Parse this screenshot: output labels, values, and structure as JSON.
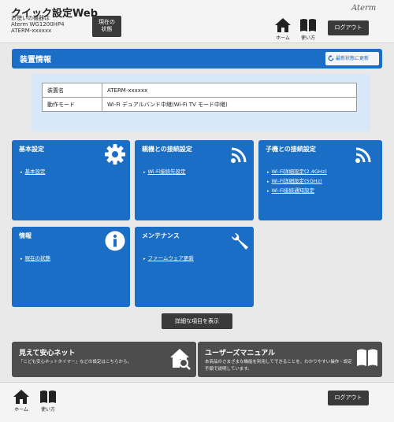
{
  "header": {
    "title": "クイック設定Web",
    "device_label": "お使いの機器は",
    "device_model": "Aterm WG1200HP4",
    "device_name": "ATERM-xxxxxx",
    "status_button": "現在の\n状態",
    "home_label": "ホーム",
    "help_label": "使い方",
    "brand": "Aterm",
    "logout_label": "ログアウト"
  },
  "device_info": {
    "title": "装置情報",
    "refresh_label": "最新状態に更新",
    "rows": [
      {
        "key": "装置名",
        "value": "ATERM-xxxxxx"
      },
      {
        "key": "動作モード",
        "value": "Wi-Fi デュアルバンド中継(Wi-Fi TV モード中継)"
      }
    ]
  },
  "tiles": [
    {
      "title": "基本設定",
      "icon": "gear-icon",
      "links": [
        "基本設定"
      ]
    },
    {
      "title": "親機との接続設定",
      "icon": "wifi-icon",
      "links": [
        "Wi-Fi接続先設定"
      ]
    },
    {
      "title": "子機との接続設定",
      "icon": "wifi-icon",
      "links": [
        "Wi-Fi詳細設定(2.4GHz)",
        "Wi-Fi詳細設定(5GHz)",
        "Wi-Fi接続通知設定"
      ]
    },
    {
      "title": "情報",
      "icon": "info-icon",
      "links": [
        "現在の状態"
      ]
    },
    {
      "title": "メンテナンス",
      "icon": "wrench-icon",
      "links": [
        "ファームウェア更新"
      ]
    }
  ],
  "detail_button": "詳細な項目を表示",
  "banners": [
    {
      "title": "見えて安心ネット",
      "desc": "「こども安心ネットタイマー」などの設定はこちらから。",
      "icon": "house-search-icon"
    },
    {
      "title": "ユーザーズマニュアル",
      "desc": "本商品のさまざまな機能を利用してできることを、わかりやすい操作・設定手順で説明しています。",
      "icon": "book-icon"
    }
  ],
  "footer": {
    "home_label": "ホーム",
    "help_label": "使い方",
    "logout_label": "ログアウト"
  },
  "colors": {
    "accent": "#1a6ec5",
    "dark_button": "#3a3a3a",
    "banner": "#4d4d4d",
    "panel": "#d8e8f8"
  }
}
